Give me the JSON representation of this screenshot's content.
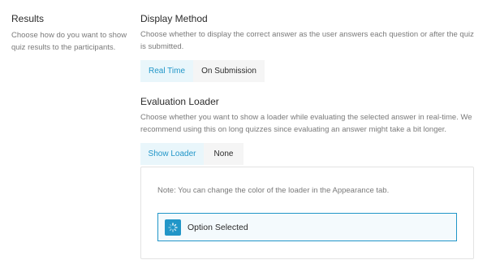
{
  "results": {
    "title": "Results",
    "description": "Choose how do you want to show quiz results to the participants."
  },
  "display_method": {
    "title": "Display Method",
    "description": "Choose whether to display the correct answer as the user answers each question or after the quiz is submitted.",
    "options": [
      "Real Time",
      "On Submission"
    ],
    "selected": "Real Time"
  },
  "evaluation_loader": {
    "title": "Evaluation Loader",
    "description": "Choose whether you want to show a loader while evaluating the selected answer in real-time. We recommend using this on long quizzes since evaluating an answer might take a bit longer.",
    "options": [
      "Show Loader",
      "None"
    ],
    "selected": "Show Loader"
  },
  "note": {
    "text": "Note: You can change the color of the loader in the Appearance tab."
  },
  "option_selected": {
    "label": "Option Selected",
    "icon": "spinner-icon"
  },
  "colors": {
    "accent": "#2196c8",
    "active_bg": "#e9f6fb",
    "inactive_bg": "#f5f5f5",
    "muted_text": "#7a7a7a"
  }
}
